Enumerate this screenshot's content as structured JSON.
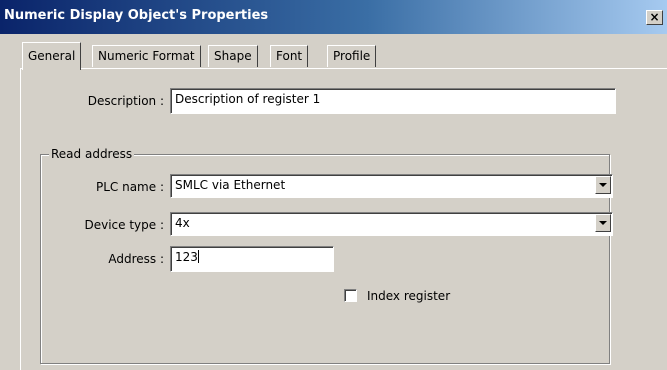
{
  "window": {
    "title": "Numeric Display Object's Properties",
    "close_label": "×"
  },
  "tabs": [
    {
      "label": "General",
      "active": true
    },
    {
      "label": "Numeric Format",
      "active": false
    },
    {
      "label": "Shape",
      "active": false
    },
    {
      "label": "Font",
      "active": false
    },
    {
      "label": "Profile",
      "active": false
    }
  ],
  "general": {
    "description_label": "Description :",
    "description_value": "Description of register 1",
    "read_address": {
      "group_label": "Read address",
      "plc_name_label": "PLC name :",
      "plc_name_value": "SMLC via Ethernet",
      "device_type_label": "Device type :",
      "device_type_value": "4x",
      "address_label": "Address :",
      "address_value": "123",
      "index_register_label": "Index register",
      "index_register_checked": false
    }
  },
  "colors": {
    "face": "#d4d0c8",
    "titlebar_start": "#0a246a",
    "titlebar_end": "#a6caf0"
  }
}
